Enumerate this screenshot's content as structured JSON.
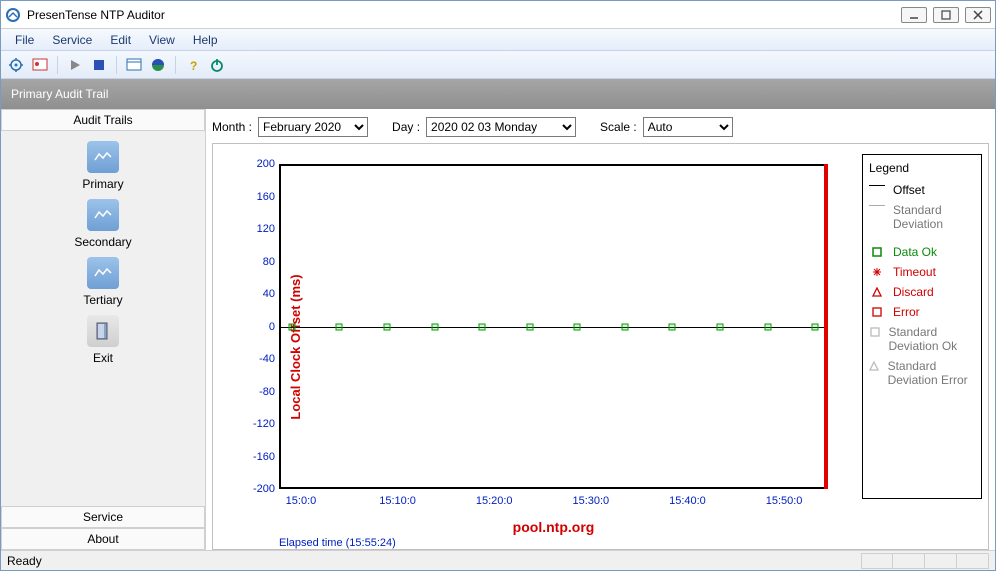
{
  "window": {
    "title": "PresenTense NTP Auditor"
  },
  "menu": {
    "file": "File",
    "service": "Service",
    "edit": "Edit",
    "view": "View",
    "help": "Help"
  },
  "pageheader": "Primary Audit Trail",
  "sidebar": {
    "header": "Audit Trails",
    "items": [
      {
        "label": "Primary"
      },
      {
        "label": "Secondary"
      },
      {
        "label": "Tertiary"
      },
      {
        "label": "Exit"
      }
    ],
    "bottom": {
      "service": "Service",
      "about": "About"
    }
  },
  "filters": {
    "month_label": "Month :",
    "month_value": "February 2020",
    "day_label": "Day :",
    "day_value": "2020 02 03 Monday",
    "scale_label": "Scale :",
    "scale_value": "Auto"
  },
  "legend": {
    "title": "Legend",
    "offset": "Offset",
    "stddev": "Standard Deviation",
    "dataok": "Data Ok",
    "timeout": "Timeout",
    "discard": "Discard",
    "error": "Error",
    "stddevok": "Standard Deviation Ok",
    "stddeverr": "Standard Deviation Error"
  },
  "status": {
    "ready": "Ready"
  },
  "chart_data": {
    "type": "line",
    "title": "pool.ntp.org",
    "ylabel": "Local Clock Offset (ms)",
    "xlabel": "",
    "ylim": [
      -200,
      200
    ],
    "yticks": [
      200,
      160,
      120,
      80,
      40,
      0,
      -40,
      -80,
      -120,
      -160,
      -200
    ],
    "xticks": [
      "15:0:0",
      "15:10:0",
      "15:20:0",
      "15:30:0",
      "15:40:0",
      "15:50:0"
    ],
    "elapsed": "Elapsed time (15:55:24)",
    "series": [
      {
        "name": "Offset",
        "x": [
          "15:00",
          "15:05",
          "15:10",
          "15:15",
          "15:20",
          "15:25",
          "15:30",
          "15:35",
          "15:40",
          "15:45",
          "15:50",
          "15:55"
        ],
        "values": [
          0,
          0,
          0,
          0,
          0,
          0,
          0,
          0,
          0,
          0,
          0,
          0
        ],
        "status": "Data Ok"
      }
    ]
  }
}
